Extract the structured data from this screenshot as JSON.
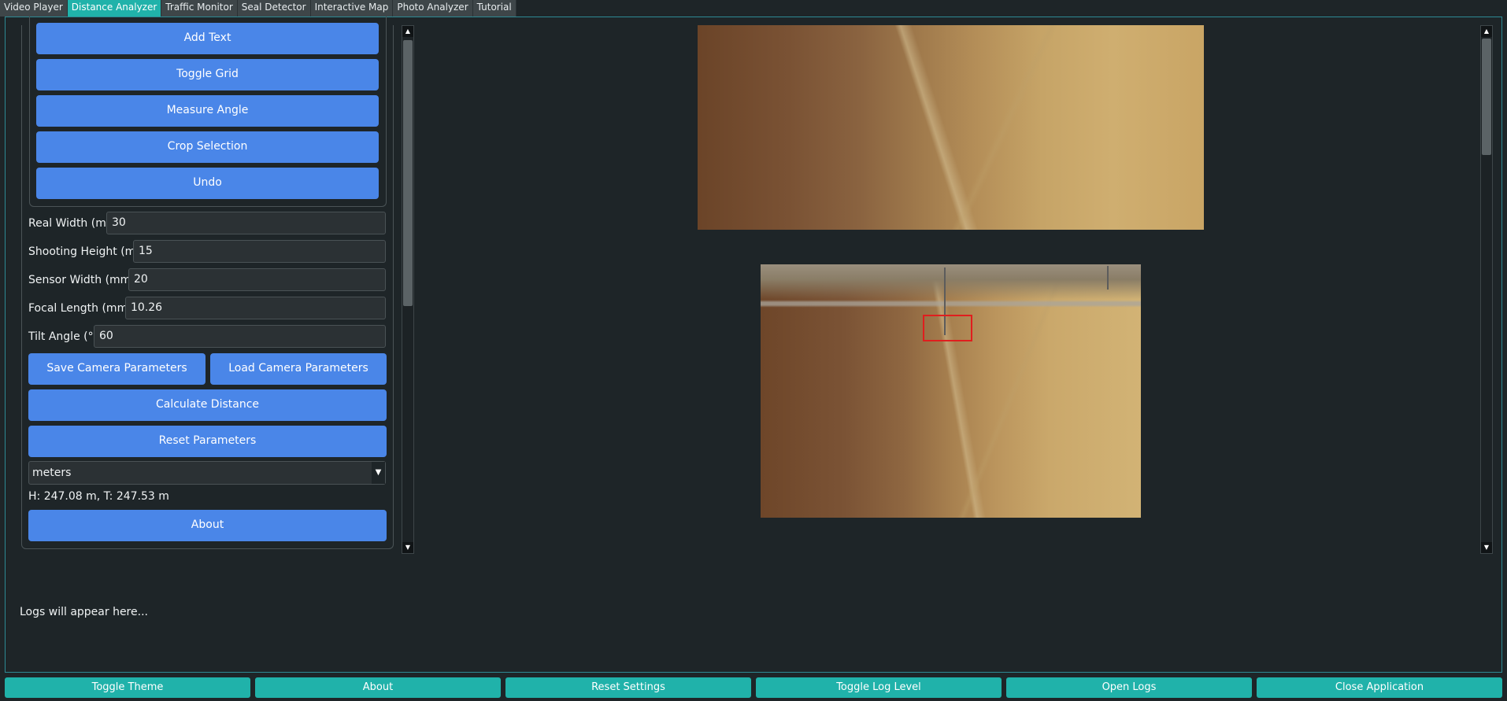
{
  "tabs": [
    {
      "label": "Video Player",
      "active": false
    },
    {
      "label": "Distance Analyzer",
      "active": true
    },
    {
      "label": "Traffic Monitor",
      "active": false
    },
    {
      "label": "Seal Detector",
      "active": false
    },
    {
      "label": "Interactive Map",
      "active": false
    },
    {
      "label": "Photo Analyzer",
      "active": false
    },
    {
      "label": "Tutorial",
      "active": false
    }
  ],
  "tools": {
    "add_text": "Add Text",
    "toggle_grid": "Toggle Grid",
    "measure_angle": "Measure Angle",
    "crop_selection": "Crop Selection",
    "undo": "Undo"
  },
  "params": {
    "real_width": {
      "label": "Real Width (m):",
      "value": "30"
    },
    "shooting_height": {
      "label": "Shooting Height (m):",
      "value": "15"
    },
    "sensor_width": {
      "label": "Sensor Width (mm):",
      "value": "20"
    },
    "focal_length": {
      "label": "Focal Length (mm):",
      "value": "10.26"
    },
    "tilt_angle": {
      "label": "Tilt Angle (°):",
      "value": "60"
    }
  },
  "actions": {
    "save_camera": "Save Camera Parameters",
    "load_camera": "Load Camera Parameters",
    "calculate": "Calculate Distance",
    "reset_params": "Reset Parameters",
    "about": "About"
  },
  "units": {
    "selected": "meters"
  },
  "result": "H: 247.08 m, T: 247.53 m",
  "log": "Logs will appear here...",
  "bottom_bar": {
    "toggle_theme": "Toggle Theme",
    "about": "About",
    "reset_settings": "Reset Settings",
    "toggle_log_level": "Toggle Log Level",
    "open_logs": "Open Logs",
    "close_app": "Close Application"
  },
  "colors": {
    "accent_teal": "#20b2aa",
    "button_blue": "#4a86e8",
    "background": "#1e2528",
    "selection_red": "#e01e1e"
  }
}
